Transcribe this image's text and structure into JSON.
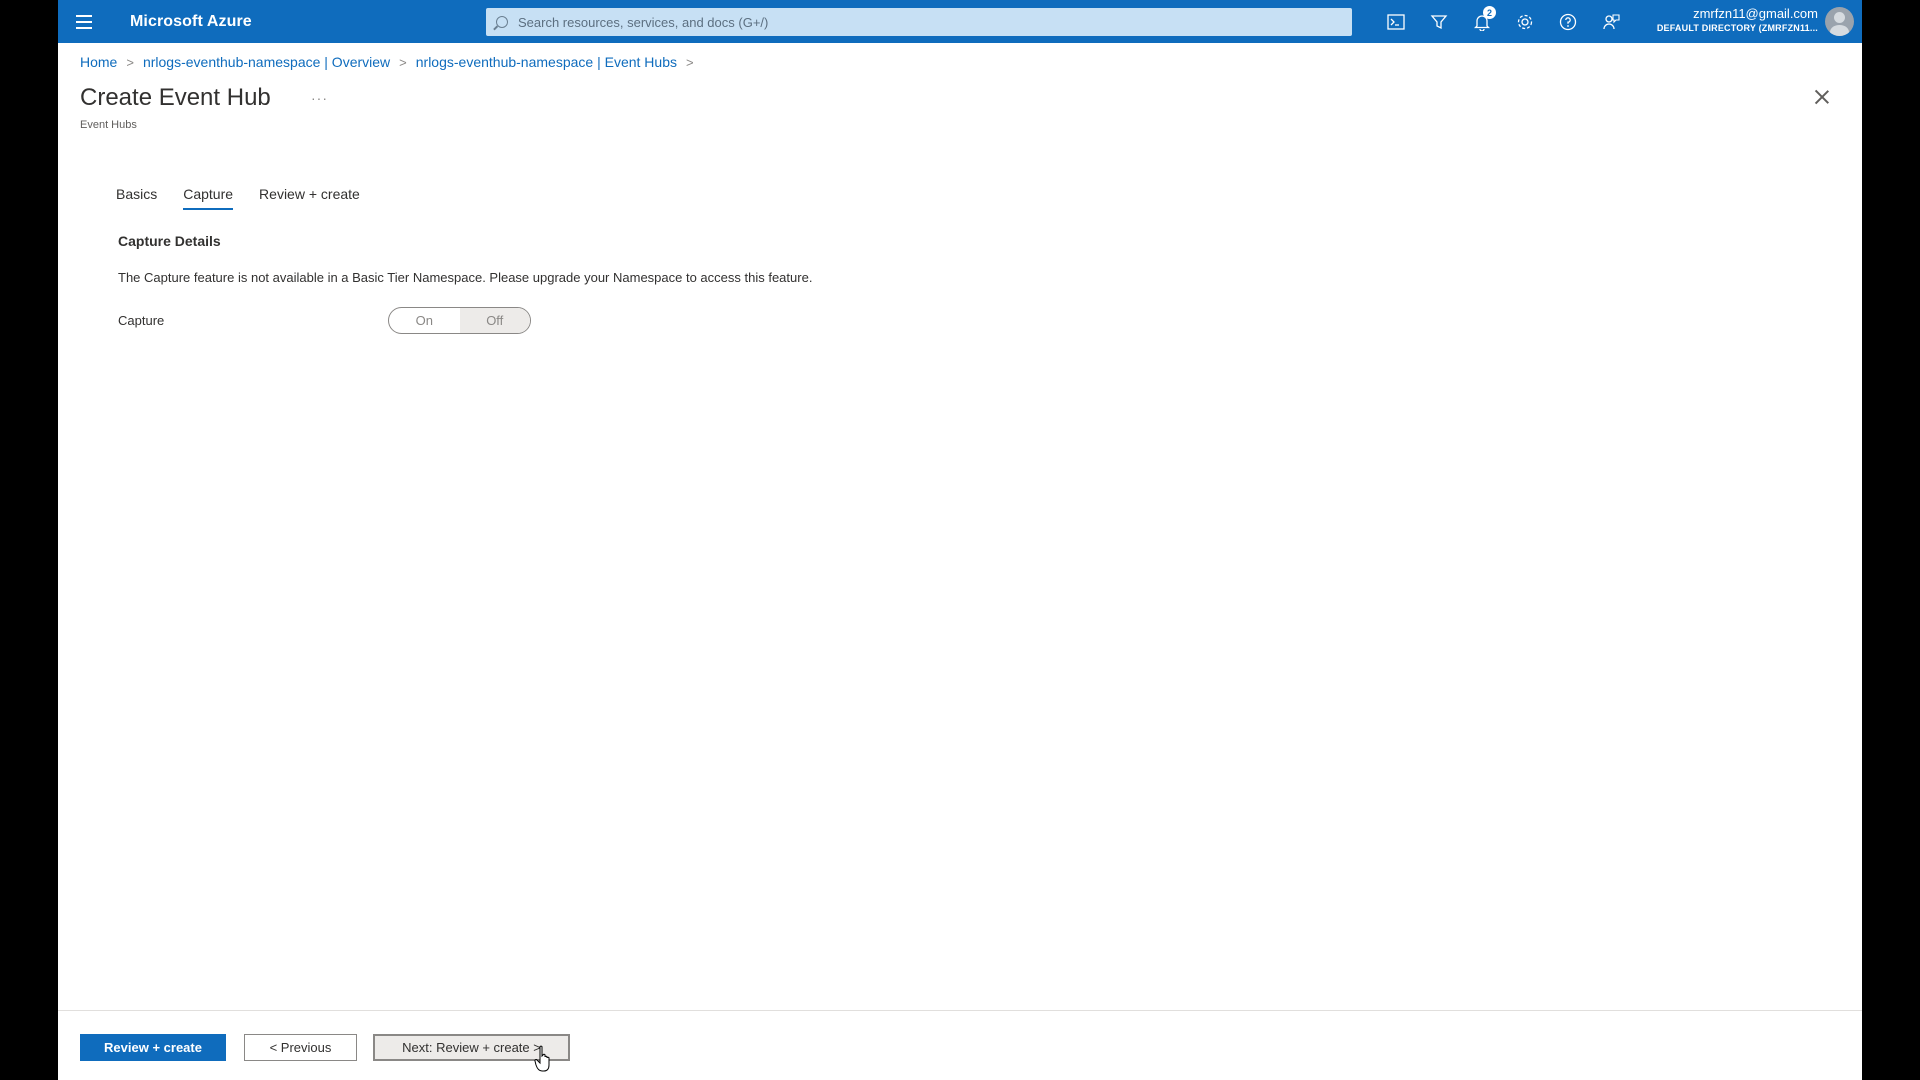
{
  "header": {
    "brand": "Microsoft Azure",
    "search_placeholder": "Search resources, services, and docs (G+/)",
    "notification_count": "2",
    "account_email": "zmrfzn11@gmail.com",
    "account_directory": "DEFAULT DIRECTORY (ZMRFZN11..."
  },
  "breadcrumb": {
    "items": [
      "Home",
      "nrlogs-eventhub-namespace | Overview",
      "nrlogs-eventhub-namespace | Event Hubs"
    ]
  },
  "page": {
    "title": "Create Event Hub",
    "more": "···",
    "subtitle": "Event Hubs"
  },
  "tabs": [
    {
      "label": "Basics",
      "active": false
    },
    {
      "label": "Capture",
      "active": true
    },
    {
      "label": "Review + create",
      "active": false
    }
  ],
  "capture": {
    "section_title": "Capture Details",
    "info_text": "The Capture feature is not available in a Basic Tier Namespace. Please upgrade your Namespace to access this feature.",
    "field_label": "Capture",
    "toggle_on": "On",
    "toggle_off": "Off",
    "selected": "Off"
  },
  "footer": {
    "review_create": "Review + create",
    "previous": "< Previous",
    "next": "Next: Review + create >"
  },
  "colors": {
    "accent": "#0f6cbd"
  }
}
